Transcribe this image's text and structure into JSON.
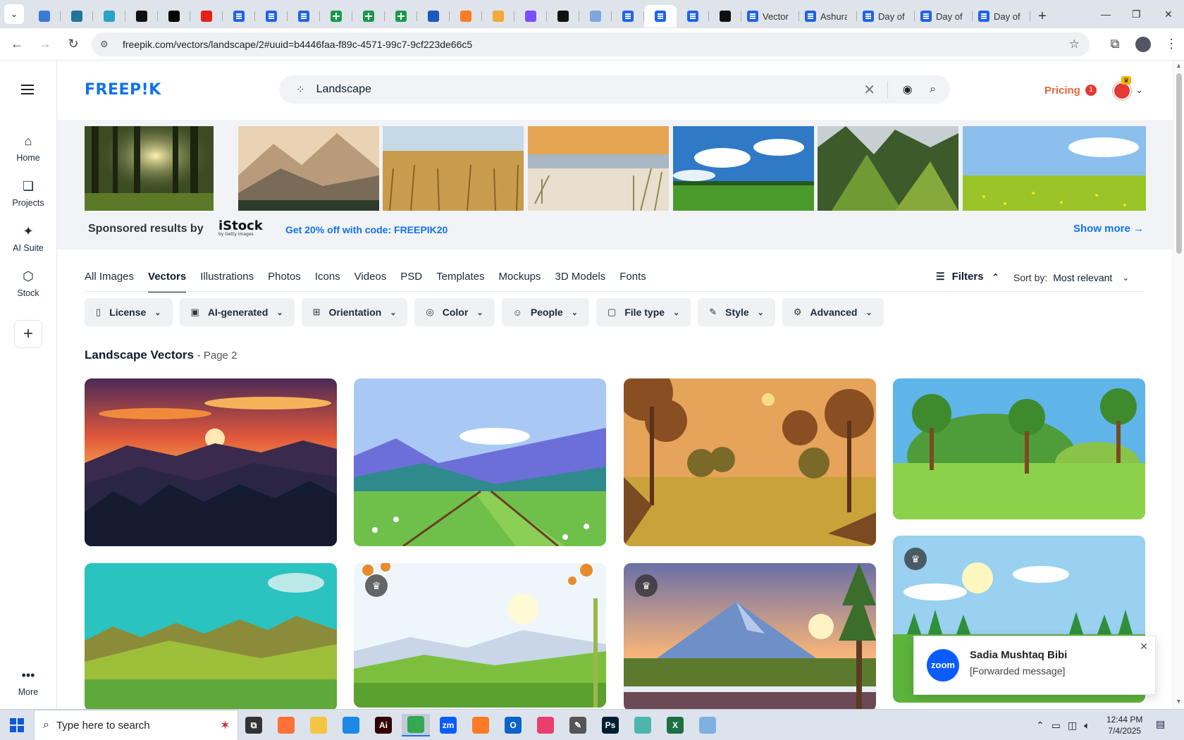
{
  "browser": {
    "tabs": [
      {
        "favicon": "globe-icon",
        "color": "#3a7bd5"
      },
      {
        "favicon": "wordpress-icon",
        "color": "#21759b"
      },
      {
        "favicon": "diamond-icon",
        "color": "#2aa3c7"
      },
      {
        "favicon": "openai-icon",
        "color": "#111111"
      },
      {
        "favicon": "bolt-icon",
        "color": "#000000"
      },
      {
        "favicon": "youtube-icon",
        "color": "#e62117"
      },
      {
        "favicon": "docs-icon",
        "color": "#1e63e9"
      },
      {
        "favicon": "docs-icon",
        "color": "#1e63e9"
      },
      {
        "favicon": "docs-icon",
        "color": "#1e63e9"
      },
      {
        "favicon": "sheets-icon",
        "color": "#1a9a4b"
      },
      {
        "favicon": "sheets-icon",
        "color": "#1a9a4b"
      },
      {
        "favicon": "sheets-icon",
        "color": "#1a9a4b"
      },
      {
        "favicon": "word-icon",
        "color": "#185abd"
      },
      {
        "favicon": "xampp-icon",
        "color": "#fb7a24"
      },
      {
        "favicon": "bird-icon",
        "color": "#f2a93b"
      },
      {
        "favicon": "code-braces-icon",
        "color": "#7c4dff"
      },
      {
        "favicon": "a-logo-icon",
        "color": "#111111"
      },
      {
        "favicon": "grid-app-icon",
        "color": "#7ea6e0"
      },
      {
        "favicon": "docs-icon",
        "color": "#1e63e9"
      },
      {
        "favicon": "docs-icon",
        "color": "#1e63e9",
        "active": true
      },
      {
        "favicon": "docs-icon",
        "color": "#1e63e9"
      },
      {
        "favicon": "medium-icon",
        "color": "#111111"
      }
    ],
    "labeled_tabs": [
      "Vector",
      "Ashura",
      "Day of",
      "Day of",
      "Day of"
    ],
    "new_tab": "+",
    "url": "freepik.com/vectors/landscape/2#uuid=b4446faa-f89c-4571-99c7-9cf223de66c5"
  },
  "sidebar": {
    "items": [
      {
        "label": "Home",
        "icon": "home-icon"
      },
      {
        "label": "Projects",
        "icon": "projects-icon"
      },
      {
        "label": "AI Suite",
        "icon": "sparkle-icon"
      },
      {
        "label": "Stock",
        "icon": "stock-icon"
      }
    ],
    "more": "More"
  },
  "header": {
    "logo": "FREEP!K",
    "search_value": "Landscape",
    "pricing": "Pricing",
    "notification_count": "1"
  },
  "sponsored": {
    "label": "Sponsored results by",
    "brand": "iStock",
    "brand_sub": "by Getty Images",
    "promo": "Get 20% off with code: FREEPIK20",
    "show_more": "Show more →",
    "images": [
      "forest-sunbeams",
      "mountain-haze",
      "wheat-field",
      "beach-dunes",
      "green-meadow-sky",
      "green-mountains",
      "yellow-flower-meadow"
    ]
  },
  "category_tabs": [
    "All Images",
    "Vectors",
    "Illustrations",
    "Photos",
    "Icons",
    "Videos",
    "PSD",
    "Templates",
    "Mockups",
    "3D Models",
    "Fonts"
  ],
  "active_tab": "Vectors",
  "filters_label": "Filters",
  "sort": {
    "label": "Sort by:",
    "value": "Most relevant"
  },
  "filter_chips": [
    {
      "label": "License",
      "icon": "license-icon"
    },
    {
      "label": "AI-generated",
      "icon": "ai-icon"
    },
    {
      "label": "Orientation",
      "icon": "orientation-icon"
    },
    {
      "label": "Color",
      "icon": "palette-icon"
    },
    {
      "label": "People",
      "icon": "people-icon"
    },
    {
      "label": "File type",
      "icon": "file-icon"
    },
    {
      "label": "Style",
      "icon": "brush-icon"
    },
    {
      "label": "Advanced",
      "icon": "gear-icon"
    }
  ],
  "results": {
    "title": "Landscape Vectors",
    "page": "- Page 2"
  },
  "toast": {
    "app": "zoom",
    "sender": "Sadia Mushtaq Bibi",
    "message": "[Forwarded message]"
  },
  "taskbar": {
    "search_placeholder": "Type here to search",
    "time": "12:44 PM",
    "date": "7/4/2025",
    "apps": [
      {
        "name": "task-view",
        "label": "⧉",
        "color": "#333"
      },
      {
        "name": "firefox",
        "label": "",
        "color": "#ff7139"
      },
      {
        "name": "file-explorer",
        "label": "",
        "color": "#f4c542"
      },
      {
        "name": "vscode",
        "label": "",
        "color": "#1e88e5"
      },
      {
        "name": "illustrator",
        "label": "Ai",
        "color": "#330000"
      },
      {
        "name": "chrome",
        "label": "",
        "color": "#34a853",
        "active": true
      },
      {
        "name": "zoom",
        "label": "zm",
        "color": "#0b5cff"
      },
      {
        "name": "xampp",
        "label": "",
        "color": "#fb7a24"
      },
      {
        "name": "outlook",
        "label": "O",
        "color": "#0a64c9"
      },
      {
        "name": "creative-cloud",
        "label": "",
        "color": "#e83f6f"
      },
      {
        "name": "pen-tool",
        "label": "✎",
        "color": "#555"
      },
      {
        "name": "photoshop",
        "label": "Ps",
        "color": "#001d34"
      },
      {
        "name": "app-diamond",
        "label": "",
        "color": "#4db6ac"
      },
      {
        "name": "excel",
        "label": "X",
        "color": "#1d7044"
      },
      {
        "name": "notepad",
        "label": "",
        "color": "#7fb0e0"
      }
    ]
  }
}
